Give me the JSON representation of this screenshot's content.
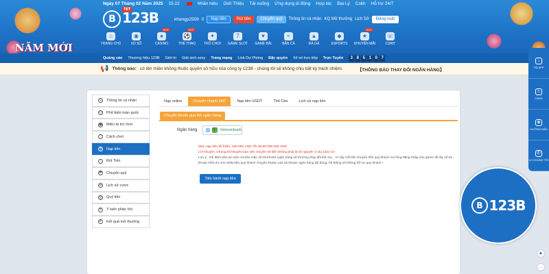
{
  "topbar": {
    "date": "Ngày 07 Tháng 02 Năm 2025",
    "time": "15:22",
    "links": [
      "Nhãn hiệu",
      "Giới Thiệu",
      "Tải xuống",
      "Ứng dụng di động",
      "Hợp tác",
      "Đại Lý",
      "Cskh",
      "Hỗ trợ 24/7"
    ]
  },
  "logo": {
    "text": "123B",
    "tet": "TET"
  },
  "account": {
    "username": "khangp2509",
    "balance": "0",
    "deposit": "Nạp tiền",
    "withdraw": "Rút tiền",
    "transfer": "Chuyển quỹ",
    "profile": "Thông tin cá nhân",
    "results": "KQ Mở thưởng",
    "history": "Lịch Sử",
    "logout": "Đăng xuất"
  },
  "nav": [
    {
      "label": "TRANG CHỦ",
      "icon": "home-icon",
      "glyph": "⌂",
      "hot": false
    },
    {
      "label": "XỔ SỐ",
      "icon": "lottery-icon",
      "glyph": "◉",
      "hot": false
    },
    {
      "label": "CASINO",
      "icon": "casino-icon",
      "glyph": "♠",
      "hot": true
    },
    {
      "label": "THỂ THAO",
      "icon": "sports-icon",
      "glyph": "⚽",
      "hot": true
    },
    {
      "label": "TRÒ CHƠI",
      "icon": "games-icon",
      "glyph": "✦",
      "hot": false
    },
    {
      "label": "GAME SLOT",
      "icon": "slot-icon",
      "glyph": "7",
      "hot": false
    },
    {
      "label": "GAME BÀI",
      "icon": "cards-icon",
      "glyph": "♥",
      "hot": false
    },
    {
      "label": "BẮN CÁ",
      "icon": "fish-icon",
      "glyph": "≈",
      "hot": false
    },
    {
      "label": "ĐÁ GÀ",
      "icon": "cockfight-icon",
      "glyph": "▲",
      "hot": false
    },
    {
      "label": "ESPORTS",
      "icon": "esports-icon",
      "glyph": "◆",
      "hot": false
    },
    {
      "label": "KHUYẾN MÃI",
      "icon": "promo-icon",
      "glyph": "★",
      "hot": true
    },
    {
      "label": "CSKH",
      "icon": "support-icon",
      "glyph": "☏",
      "hot": false
    }
  ],
  "banner_text": "NĂM MỚI",
  "subbar": {
    "ad": "Quảng cáo",
    "brand": "Thương hiệu 123B",
    "intro": "Giới tri",
    "sexy": "Giải sinh sexy",
    "homepage": "Trang mạng",
    "backup": "Link Dự Phòng",
    "rights": "Đặc quyền",
    "lottery": "Xổ số trực tiếp",
    "online_label": "Trực Tuyến",
    "online_digits": [
      "3",
      "8",
      "5",
      "1",
      "0",
      "7"
    ]
  },
  "notice": {
    "label": "Thông báo:",
    "text": "có tên miền không thuộc quyền sở hữu của công ty 123B - chúng tôi sẽ không chịu bất kỳ trách nhiệm.",
    "headline": "【THÔNG BÁO THAY ĐỔI NGÂN HÀNG】"
  },
  "menu": [
    {
      "label": "Thông tin cá nhân",
      "icon": "user-icon",
      "glyph": "☺"
    },
    {
      "label": "Phổ biến toàn quốc",
      "icon": "diamond-icon",
      "glyph": "◇"
    },
    {
      "label": "Miêu tả trò chơi",
      "icon": "game-desc-icon",
      "glyph": "▣"
    },
    {
      "label": "Cách chơi",
      "icon": "howto-icon",
      "glyph": "?"
    },
    {
      "label": "Nạp tiền",
      "icon": "deposit-icon",
      "glyph": "$",
      "active": true
    },
    {
      "label": "Rút Tiền",
      "icon": "withdraw-icon",
      "glyph": "↑"
    },
    {
      "label": "Chuyển quỹ",
      "icon": "transfer-icon",
      "glyph": "⇄"
    },
    {
      "label": "Lịch sử cược",
      "icon": "bet-history-icon",
      "glyph": "☰"
    },
    {
      "label": "Quỹ tiền",
      "icon": "fund-icon",
      "glyph": "◎"
    },
    {
      "label": "Ý kiến phản hồi",
      "icon": "feedback-icon",
      "glyph": "✎"
    },
    {
      "label": "Kết quả mở thưởng",
      "icon": "results-icon",
      "glyph": "✔"
    }
  ],
  "tabs": [
    "Nạp online",
    "Chuyển nhanh 24/7",
    "Nạp tiền USDT",
    "Thẻ Cào",
    "Lịch sử nạp tiền"
  ],
  "subtab": "Chuyển khoản qua thẻ ngân hàng",
  "bank": {
    "label": "Ngân hàng",
    "selected": "Vietcombank"
  },
  "warnings": {
    "line1": "Mức nạp tiền tối thiểu: 100.000 VND Tối đa:90.000.000 VND",
    "line2": "Lời khuyên: Chúng tôi khuyên bạn nên chuyển số tiền không phải là số nguyên  ví dụ 1021-10",
    "note": "Lưu ý : Để đảm bảo an toàn và bảo mật, số tài khoản ngân hàng sẽ thường thay đổi liên tục .  Vì vậy mỗi lần chuyển tiền quý khách vui lòng đăng nhập vào game để lấy số tài khoản hiển thị mới nhất.Nếu quý khách chuyển khoản vào tài khoản ngân hàng đã đóng, hệ thống sẽ không hỗ trợ quý khách !"
  },
  "submit": "Tiến hành nạp tiền",
  "dock": [
    {
      "label": "TẢI APP",
      "icon": "download-app-icon",
      "glyph": "↓"
    },
    {
      "label": "CSKH",
      "icon": "support-chat-icon",
      "glyph": "☺"
    },
    {
      "label": "HƯỚNG DẪN",
      "icon": "guide-icon",
      "glyph": "◈"
    },
    {
      "label": "LH CHÚNG TÔI",
      "icon": "phone-icon",
      "glyph": "✆"
    }
  ],
  "badge_logo": "123B",
  "scroll_up": "▲",
  "scroll_more": "…"
}
